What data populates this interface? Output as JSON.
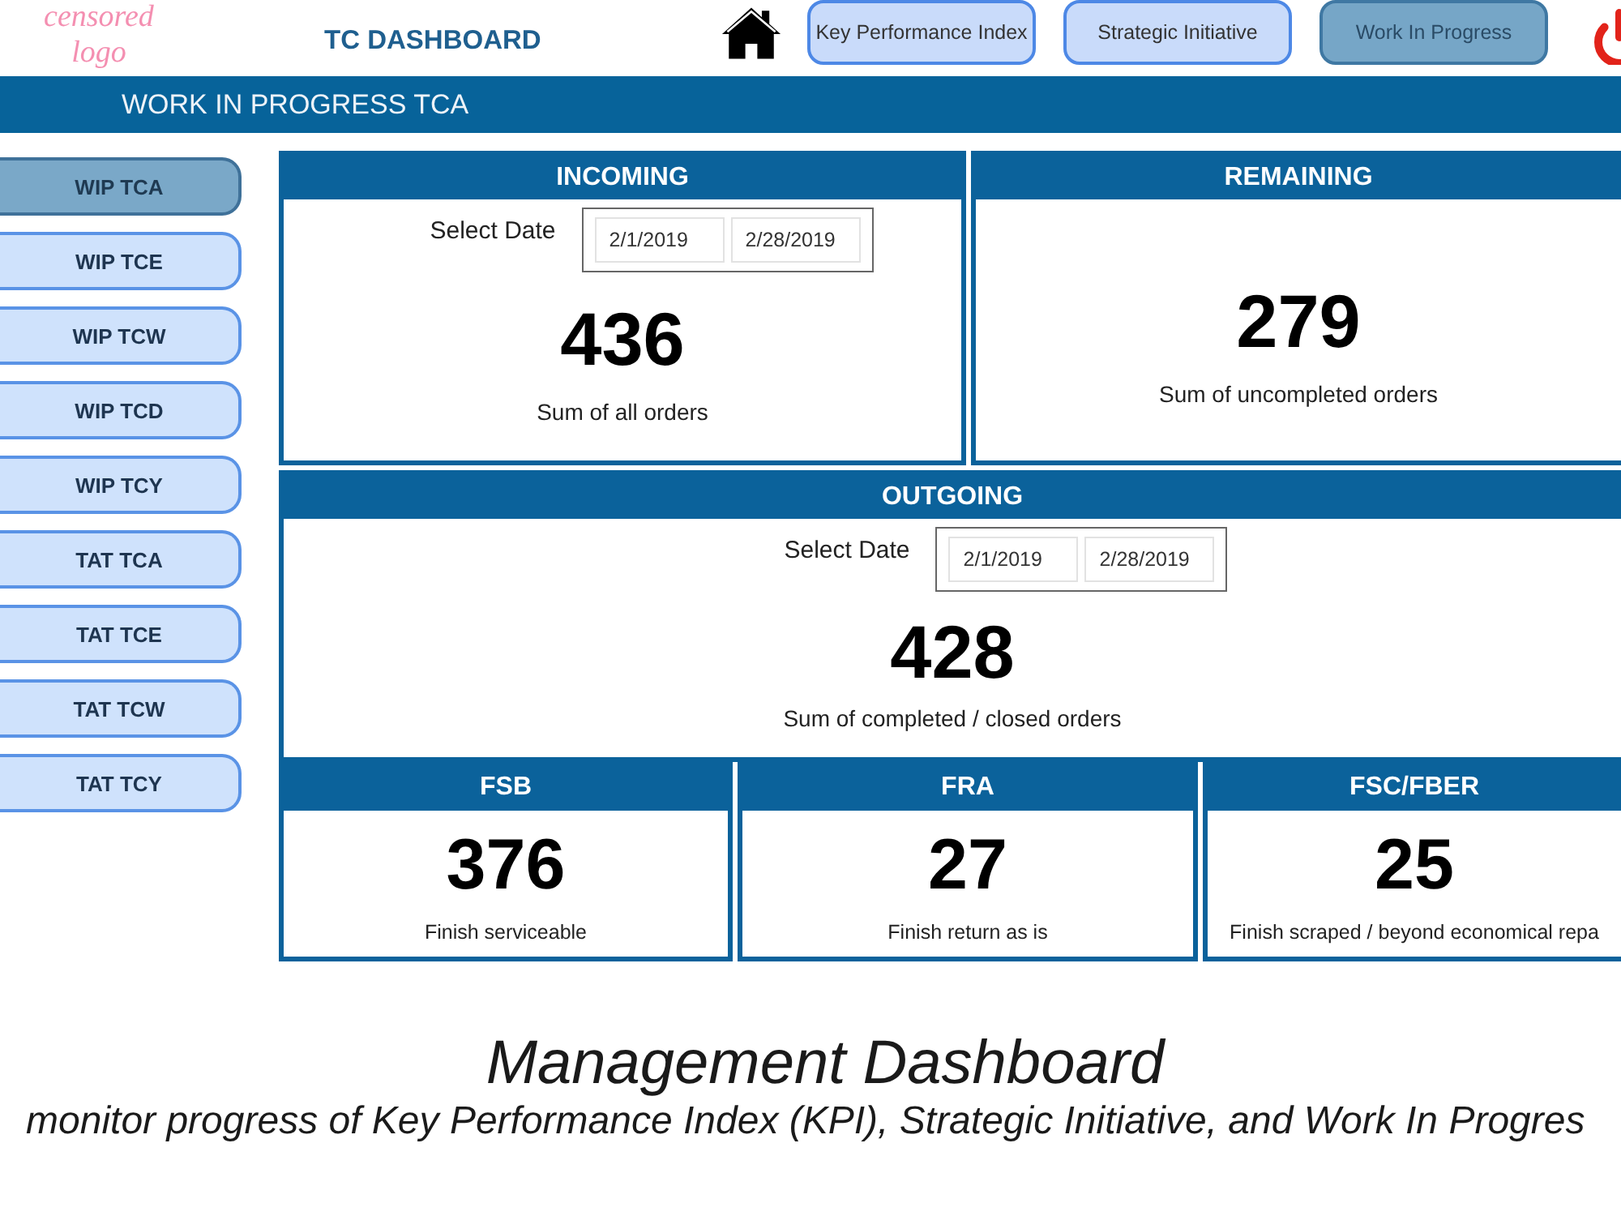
{
  "header": {
    "logo_text": "censored logo",
    "title": "TC DASHBOARD",
    "nav": [
      {
        "label": "Key Performance Index",
        "selected": false
      },
      {
        "label": "Strategic Initiative",
        "selected": false
      },
      {
        "label": "Work In Progress",
        "selected": true
      }
    ]
  },
  "banner": {
    "title": "WORK IN PROGRESS TCA"
  },
  "sidebar": {
    "items": [
      {
        "label": "WIP TCA",
        "selected": true
      },
      {
        "label": "WIP TCE",
        "selected": false
      },
      {
        "label": "WIP TCW",
        "selected": false
      },
      {
        "label": "WIP TCD",
        "selected": false
      },
      {
        "label": "WIP TCY",
        "selected": false
      },
      {
        "label": "TAT TCA",
        "selected": false
      },
      {
        "label": "TAT TCE",
        "selected": false
      },
      {
        "label": "TAT TCW",
        "selected": false
      },
      {
        "label": "TAT TCY",
        "selected": false
      }
    ]
  },
  "incoming": {
    "title": "INCOMING",
    "date_label": "Select Date",
    "date_from": "2/1/2019",
    "date_to": "2/28/2019",
    "value": "436",
    "caption": "Sum of all orders"
  },
  "remaining": {
    "title": "REMAINING",
    "value": "279",
    "caption": "Sum of uncompleted orders"
  },
  "outgoing": {
    "title": "OUTGOING",
    "date_label": "Select Date",
    "date_from": "2/1/2019",
    "date_to": "2/28/2019",
    "value": "428",
    "caption": "Sum of completed / closed orders"
  },
  "breakdown": [
    {
      "title": "FSB",
      "value": "376",
      "caption": "Finish serviceable"
    },
    {
      "title": "FRA",
      "value": "27",
      "caption": "Finish return as is"
    },
    {
      "title": "FSC/FBER",
      "value": "25",
      "caption": "Finish scraped / beyond economical repa"
    }
  ],
  "slide": {
    "title": "Management Dashboard",
    "subtitle": "monitor progress of Key Performance Index (KPI), Strategic Initiative, and Work In Progres"
  }
}
